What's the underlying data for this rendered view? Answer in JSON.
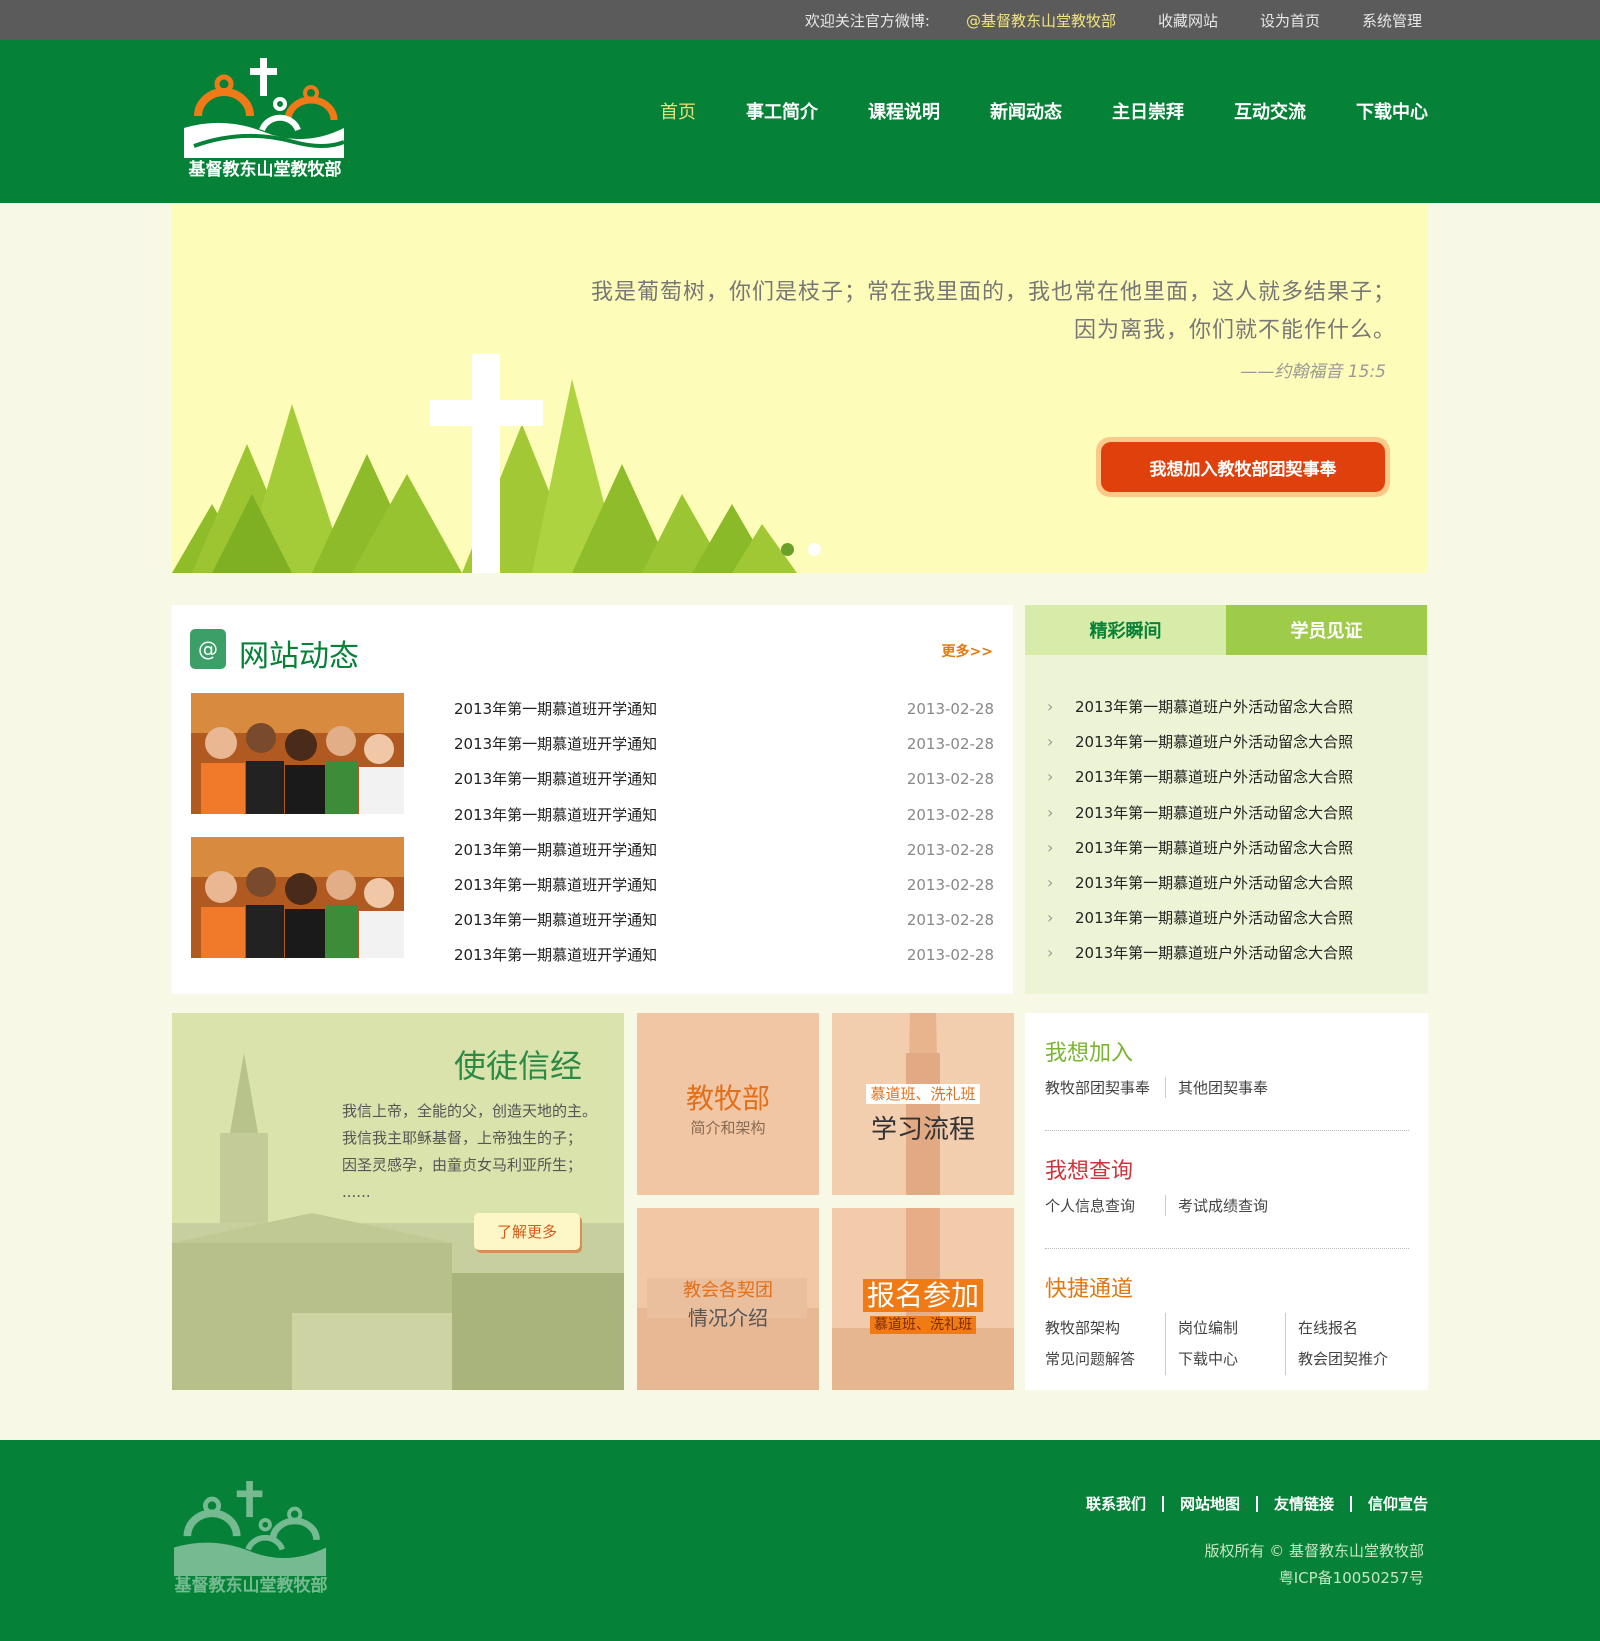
{
  "topbar": {
    "welcome": "欢迎关注官方微博:",
    "weibo": "@基督教东山堂教牧部",
    "favorite": "收藏网站",
    "homepage": "设为首页",
    "admin": "系统管理"
  },
  "header": {
    "logo_text": "基督教东山堂教牧部",
    "nav": [
      "首页",
      "事工简介",
      "课程说明",
      "新闻动态",
      "主日崇拜",
      "互动交流",
      "下载中心"
    ]
  },
  "banner": {
    "verse_line1": "我是葡萄树，你们是枝子；常在我里面的，我也常在他里面，这人就多结果子；",
    "verse_line2": "因为离我，你们就不能作什么。",
    "verse_source": "——约翰福音 15:5",
    "button": "我想加入教牧部团契事奉"
  },
  "news": {
    "title": "网站动态",
    "more": "更多>>",
    "items": [
      {
        "title": "2013年第一期慕道班开学通知",
        "date": "2013-02-28"
      },
      {
        "title": "2013年第一期慕道班开学通知",
        "date": "2013-02-28"
      },
      {
        "title": "2013年第一期慕道班开学通知",
        "date": "2013-02-28"
      },
      {
        "title": "2013年第一期慕道班开学通知",
        "date": "2013-02-28"
      },
      {
        "title": "2013年第一期慕道班开学通知",
        "date": "2013-02-28"
      },
      {
        "title": "2013年第一期慕道班开学通知",
        "date": "2013-02-28"
      },
      {
        "title": "2013年第一期慕道班开学通知",
        "date": "2013-02-28"
      },
      {
        "title": "2013年第一期慕道班开学通知",
        "date": "2013-02-28"
      }
    ]
  },
  "tabs": {
    "tab1": "精彩瞬间",
    "tab2": "学员见证",
    "items": [
      "2013年第一期慕道班户外活动留念大合照",
      "2013年第一期慕道班户外活动留念大合照",
      "2013年第一期慕道班户外活动留念大合照",
      "2013年第一期慕道班户外活动留念大合照",
      "2013年第一期慕道班户外活动留念大合照",
      "2013年第一期慕道班户外活动留念大合照",
      "2013年第一期慕道班户外活动留念大合照",
      "2013年第一期慕道班户外活动留念大合照"
    ]
  },
  "creed": {
    "title": "使徒信经",
    "line1": "我信上帝，全能的父，创造天地的主。",
    "line2": "我信我主耶稣基督，上帝独生的子；",
    "line3": "因圣灵感孕，由童贞女马利亚所生；",
    "line4": "......",
    "button": "了解更多"
  },
  "tiles": {
    "t1_main": "教牧部",
    "t1_sub": "简介和架构",
    "t2_tag": "慕道班、洗礼班",
    "t2_main": "学习流程",
    "t3_tag": "教会各契团",
    "t3_main": "情况介绍",
    "t4_main": "报名参加",
    "t4_sub": "慕道班、洗礼班"
  },
  "quick": {
    "join_title": "我想加入",
    "join_links": [
      "教牧部团契事奉",
      "其他团契事奉"
    ],
    "query_title": "我想查询",
    "query_links": [
      "个人信息查询",
      "考试成绩查询"
    ],
    "fast_title": "快捷通道",
    "fast_links": [
      "教牧部架构",
      "岗位编制",
      "在线报名",
      "常见问题解答",
      "下载中心",
      "教会团契推介"
    ]
  },
  "footer": {
    "logo_text": "基督教东山堂教牧部",
    "links": [
      "联系我们",
      "网站地图",
      "友情链接",
      "信仰宣告"
    ],
    "copyright": "版权所有 © 基督教东山堂教牧部",
    "icp": "粤ICP备10050257号"
  },
  "colors": {
    "brand_green": "#058237",
    "topbar_gray": "#5b5b5b",
    "accent_orange": "#e07b12",
    "join_red": "#e0400c",
    "query_red": "#d0343a",
    "fast_orange": "#e2770f",
    "join_green": "#7ab433"
  }
}
